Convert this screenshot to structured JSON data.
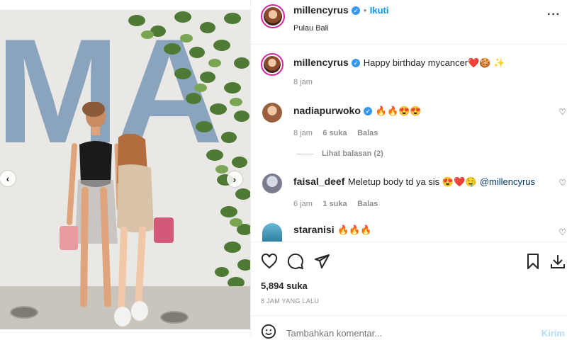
{
  "post": {
    "username": "millencyrus",
    "follow_label": "Ikuti",
    "location": "Pulau Bali",
    "more_icon": "more-horizontal-icon"
  },
  "caption": {
    "username": "millencyrus",
    "text": "Happy birthday mycancer❤️🍪 ✨",
    "time": "8 jam"
  },
  "comments": [
    {
      "username": "nadiapurwoko",
      "verified": true,
      "text": "🔥🔥😍😍",
      "time": "8 jam",
      "likes": "6 suka",
      "reply": "Balas",
      "view_replies": "Lihat balasan (2)"
    },
    {
      "username": "faisal_deef",
      "verified": false,
      "text": "Meletup body td ya sis 😍❤️🤤",
      "mention": "@millencyrus",
      "time": "6 jam",
      "likes": "1 suka",
      "reply": "Balas"
    },
    {
      "username": "staranisi",
      "verified": false,
      "text": "🔥🔥🔥"
    }
  ],
  "stats": {
    "likes": "5,894 suka",
    "posted": "8 JAM YANG LALU"
  },
  "composer": {
    "placeholder": "Tambahkan komentar...",
    "submit_label": "Kirim"
  },
  "colors": {
    "verified": "#3897f0",
    "link": "#00376b",
    "submit": "#b2dffc"
  }
}
